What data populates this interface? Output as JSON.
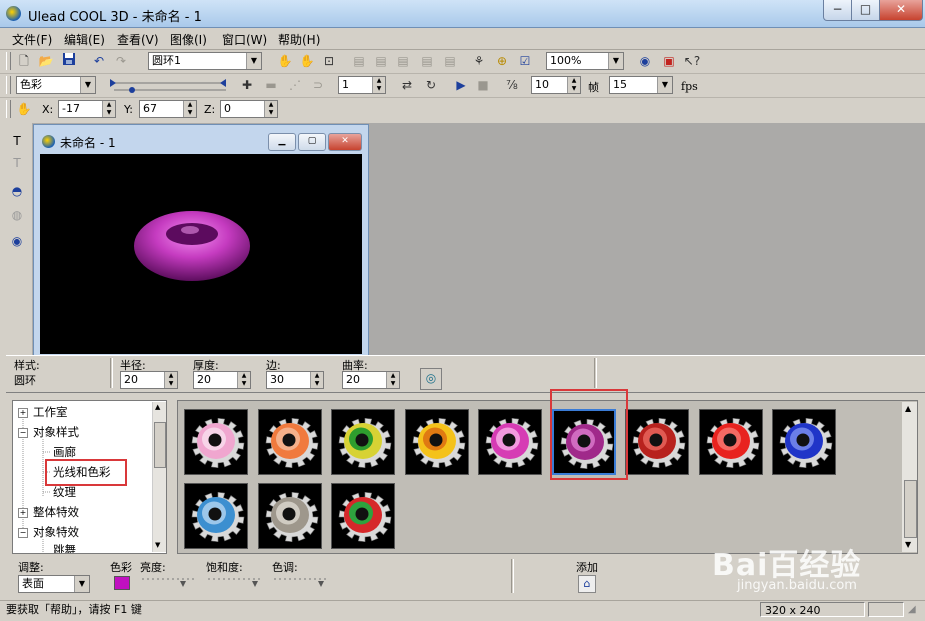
{
  "window": {
    "title": "Ulead COOL 3D - 未命名 - 1",
    "min": "−",
    "max": "□",
    "close": "✕"
  },
  "menu": [
    "文件(F)",
    "编辑(E)",
    "查看(V)",
    "图像(I)",
    "窗口(W)",
    "帮助(H)"
  ],
  "toolbar1": {
    "object_combo": "圆环1",
    "zoom_combo": "100%"
  },
  "toolbar2": {
    "attr_combo": "色彩",
    "frame_value": "1",
    "frame_count": "10",
    "frame_label": "帧",
    "fps_value": "15",
    "fps_label": "fps"
  },
  "toolbar3": {
    "x_label": "X:",
    "x_value": "-17",
    "y_label": "Y:",
    "y_value": "67",
    "z_label": "Z:",
    "z_value": "0"
  },
  "document": {
    "title": "未命名 - 1"
  },
  "props": {
    "style_label": "样式:",
    "style_value": "圆环",
    "radius_label": "半径:",
    "radius_value": "20",
    "thickness_label": "厚度:",
    "thickness_value": "20",
    "sides_label": "边:",
    "sides_value": "30",
    "curve_label": "曲率:",
    "curve_value": "20"
  },
  "tree": [
    {
      "label": "工作室",
      "box": "+"
    },
    {
      "label": "对象样式",
      "box": "−"
    },
    {
      "label": "画廊",
      "box": ""
    },
    {
      "label": "光线和色彩",
      "box": ""
    },
    {
      "label": "纹理",
      "box": ""
    },
    {
      "label": "整体特效",
      "box": "+"
    },
    {
      "label": "对象特效",
      "box": "−"
    },
    {
      "label": "跳舞",
      "box": ""
    }
  ],
  "gallery": [
    {
      "outer": "#f0a6cf",
      "inner": "#f7d4e8"
    },
    {
      "outer": "#f07a3e",
      "inner": "#f5b08a"
    },
    {
      "outer": "#d7d234",
      "inner": "#2e9d2e"
    },
    {
      "outer": "#f4c21a",
      "inner": "#e07a12"
    },
    {
      "outer": "#d63cb4",
      "inner": "#f29ade"
    },
    {
      "outer": "#a0298a",
      "inner": "#d06bc0"
    },
    {
      "outer": "#b8221e",
      "inner": "#e05a52"
    },
    {
      "outer": "#e8231f",
      "inner": "#f46a63"
    },
    {
      "outer": "#2035c8",
      "inner": "#6b7fe8"
    },
    {
      "outer": "#3c8fd0",
      "inner": "#9cc7ea"
    },
    {
      "outer": "#9e978c",
      "inner": "#d0cbc2"
    },
    {
      "outer": "#d6282a",
      "inner": "#2ea23e"
    }
  ],
  "adjust": {
    "adjust_label": "调整:",
    "adjust_value": "表面",
    "color_label": "色彩",
    "color_swatch": "#c010c0",
    "brightness_label": "亮度:",
    "saturation_label": "饱和度:",
    "hue_label": "色调:",
    "add_label": "添加"
  },
  "status": {
    "help_text": "要获取「帮助」，请按 F1 键",
    "size": "320 x 240"
  },
  "watermark": {
    "logo": "Bai百经验",
    "sub": "jingyan.baidu.com"
  },
  "colors": {
    "highlight_box": "#d9383a",
    "selected_thumb": "#3a7bd5"
  }
}
